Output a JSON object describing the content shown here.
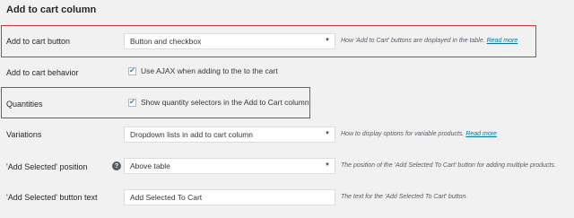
{
  "section": {
    "title": "Add to cart column"
  },
  "rows": {
    "add_to_cart_button": {
      "label": "Add to cart button",
      "value": "Button and checkbox",
      "desc": "How 'Add to Cart' buttons are displayed in the table.",
      "link": "Read more"
    },
    "add_to_cart_behavior": {
      "label": "Add to cart behavior",
      "checkbox_label": "Use AJAX when adding to the to the cart",
      "checked": true
    },
    "quantities": {
      "label": "Quantities",
      "checkbox_label": "Show quantity selectors in the Add to Cart column",
      "checked": true
    },
    "variations": {
      "label": "Variations",
      "value": "Dropdown lists in add to cart column",
      "desc": "How to display options for variable products.",
      "link": "Read more"
    },
    "add_selected_position": {
      "label": "'Add Selected' position",
      "help_icon": "?",
      "value": "Above table",
      "desc": "The position of the 'Add Selected To Cart' button for adding multiple products."
    },
    "add_selected_text": {
      "label": "'Add Selected' button text",
      "value": "Add Selected To Cart",
      "desc": "The text for the 'Add Selected To Cart' button."
    }
  },
  "icons": {
    "dropdown_arrow": "▼",
    "checkmark": "✔"
  },
  "colors": {
    "highlight": "#dc3232",
    "link": "#0073aa",
    "checkmark": "#1e8cbe"
  }
}
